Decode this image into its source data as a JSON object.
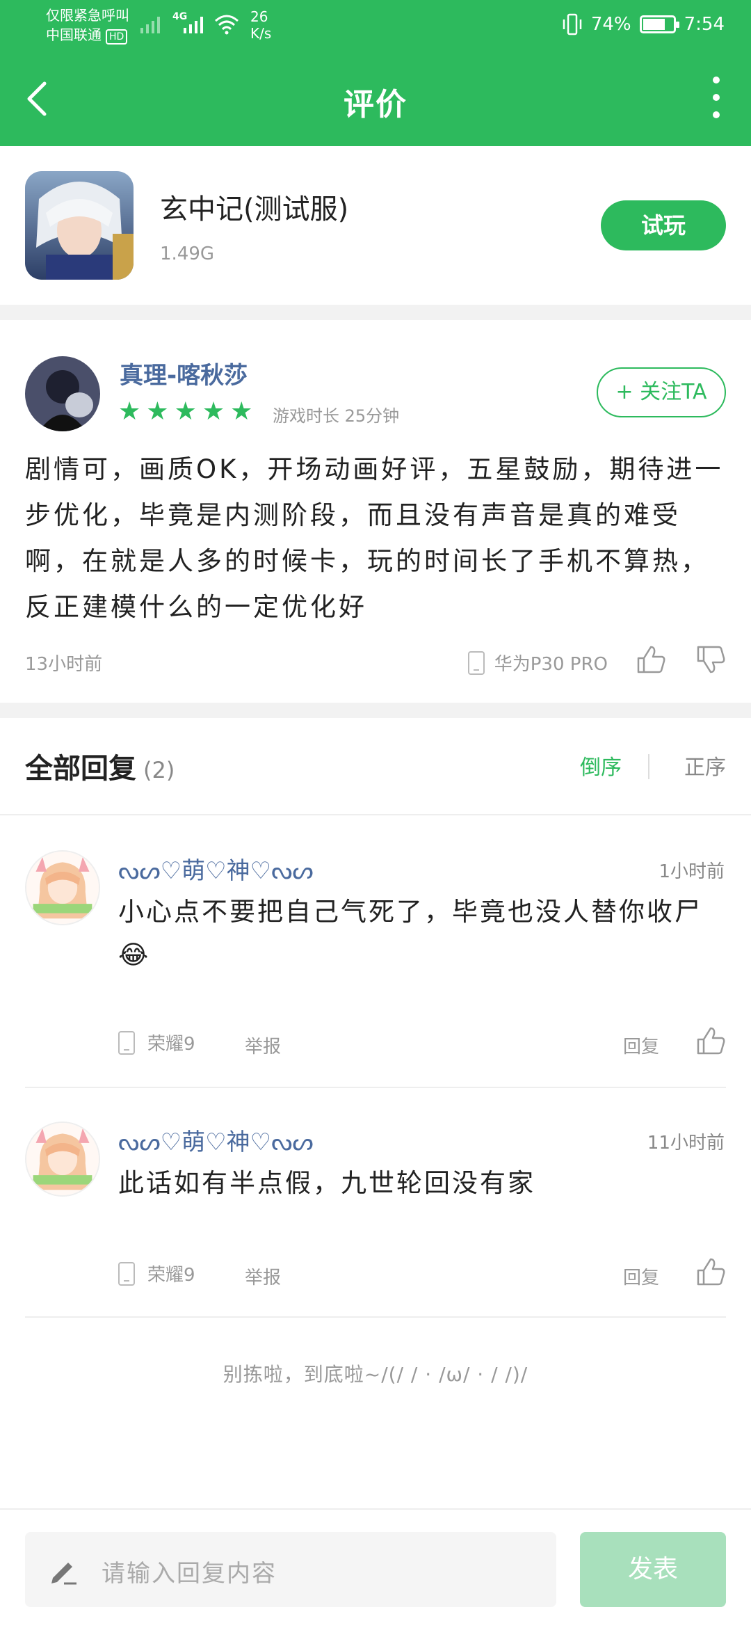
{
  "status_bar": {
    "line1": "仅限紧急呼叫",
    "line2": "中国联通",
    "hd_badge": "HD",
    "network": "4G",
    "speed_value": "26",
    "speed_unit": "K/s",
    "battery_text": "74%",
    "battery_level": 0.74,
    "time": "7:54"
  },
  "nav": {
    "title": "评价"
  },
  "app": {
    "name": "玄中记(测试服)",
    "size": "1.49G",
    "try_label": "试玩"
  },
  "review": {
    "reviewer_name": "真理-喀秋莎",
    "rating": 5,
    "max_rating": 5,
    "play_time": "游戏时长  25分钟",
    "follow_label": "+ 关注TA",
    "text": "剧情可，画质OK，开场动画好评，五星鼓励，期待进一步优化，毕竟是内测阶段，而且没有声音是真的难受啊，在就是人多的时候卡，玩的时间长了手机不算热，反正建模什么的一定优化好",
    "time": "13小时前",
    "device": "华为P30 PRO"
  },
  "replies_header": {
    "title": "全部回复",
    "count": "(2)",
    "sort_desc": "倒序",
    "sort_asc": "正序"
  },
  "replies": [
    {
      "name": "ᔓᔕ♡萌♡神♡ᔓᔕ",
      "time": "1小时前",
      "text": "小心点不要把自己气死了，毕竟也没人替你收尸😂",
      "device": "荣耀9",
      "report": "举报",
      "reply": "回复"
    },
    {
      "name": "ᔓᔕ♡萌♡神♡ᔓᔕ",
      "time": "11小时前",
      "text": "此话如有半点假，九世轮回没有家",
      "device": "荣耀9",
      "report": "举报",
      "reply": "回复"
    }
  ],
  "end_text": "别拣啦，到底啦~/(/ / · /ω/ · / /)/",
  "bottom": {
    "placeholder": "请输入回复内容",
    "publish_label": "发表"
  },
  "colors": {
    "brand_green": "#2dba5d",
    "name_blue": "#4a6a9e",
    "publish_disabled": "#a8e0bc"
  }
}
